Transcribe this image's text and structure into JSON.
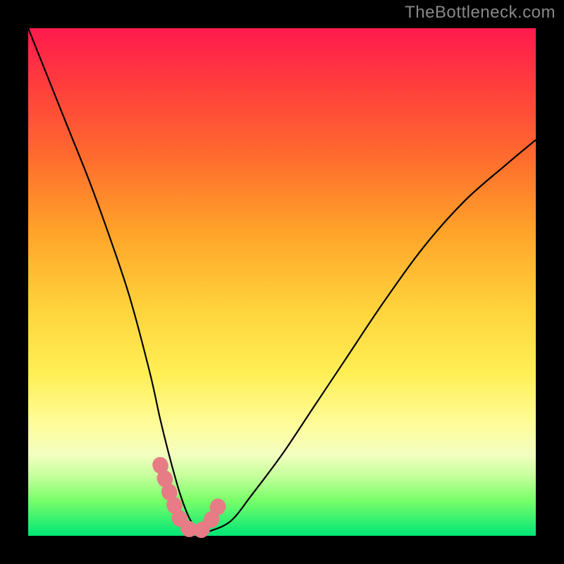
{
  "watermark": "TheBottleneck.com",
  "chart_data": {
    "type": "line",
    "title": "",
    "xlabel": "",
    "ylabel": "",
    "xlim": [
      0,
      100
    ],
    "ylim": [
      0,
      100
    ],
    "series": [
      {
        "name": "bottleneck-curve",
        "x": [
          0,
          4,
          8,
          12,
          16,
          20,
          24,
          26,
          28,
          30,
          32,
          34,
          36,
          40,
          44,
          50,
          56,
          62,
          70,
          78,
          86,
          94,
          100
        ],
        "y": [
          100,
          90,
          80,
          70,
          59,
          47,
          32,
          23,
          15,
          8,
          3,
          1,
          1,
          3,
          8,
          16,
          25,
          34,
          46,
          57,
          66,
          73,
          78
        ]
      }
    ],
    "highlight": {
      "name": "near-optimum-band",
      "x": [
        26,
        28,
        30,
        32,
        34,
        36,
        38
      ],
      "y": [
        14,
        8,
        3,
        1,
        1,
        3,
        7
      ],
      "color": "#e77b86"
    },
    "gradient_stops": [
      {
        "pos": 0.0,
        "color": "#ff1a4d"
      },
      {
        "pos": 0.25,
        "color": "#ff6a2e"
      },
      {
        "pos": 0.55,
        "color": "#ffd23b"
      },
      {
        "pos": 0.8,
        "color": "#fffc9a"
      },
      {
        "pos": 1.0,
        "color": "#00e676"
      }
    ]
  }
}
